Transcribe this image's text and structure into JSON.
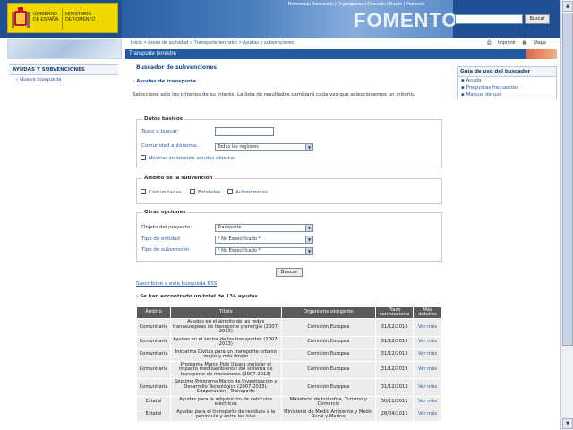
{
  "header": {
    "gov_line1": "GOBIERNO",
    "gov_line2": "DE ESPAÑA",
    "ministry_line1": "MINISTERIO",
    "ministry_line2": "DE FOMENTO",
    "topnav": "Bienvenida Bienvenido | Organigrama | Dirección | Buzón | Protocolo",
    "brand": "FOMENTO",
    "search_button": "Buscar"
  },
  "breadcrumb": "Inicio > Áreas de actividad > Transporte terrestre > Ayudas y subvenciones",
  "util": {
    "print": "Imprimir",
    "map": "Mapa"
  },
  "section_title": "Transporte terrestre",
  "sidebar": {
    "title": "AYUDAS Y SUBVENCIONES",
    "items": [
      "Nueva búsqueda"
    ]
  },
  "main": {
    "title": "Buscador de subvenciones",
    "subtitle": "Ayudas de transporte",
    "intro": "Seleccione sólo los criterios de su interés. La lista de resultados cambiará cada vez que seleccionemos un criterio.",
    "basic": {
      "legend": "Datos básicos",
      "text_label": "Texto a buscar:",
      "text_value": "",
      "community_label": "Comunidad autónoma:",
      "community_value": "Todas las regiones",
      "open_only_label": "Mostrar solamente ayudas abiertas"
    },
    "scope": {
      "legend": "Ámbito de la subvención",
      "options": [
        "Comunitarias",
        "Estatales",
        "Autonómicas"
      ]
    },
    "other": {
      "legend": "Otras opciones",
      "object_label": "Objeto del proyecto:",
      "object_value": "Transporte",
      "entity_label": "Tipo de entidad",
      "entity_value": "* No Especificado *",
      "subsidy_label": "Tipo de subvención",
      "subsidy_value": "* No Especificado *"
    },
    "search_button": "Buscar",
    "rss_link": "Suscribirse a esta búsqueda RSS",
    "found_text": "Se han encontrado un total de 134 ayudas"
  },
  "table": {
    "headers": [
      "Ámbito",
      "Título",
      "Organismo otorgante",
      "Plazo convocatoria",
      "Más detalles"
    ],
    "rows": [
      [
        "Comunitaria",
        "Ayudas en el ámbito de las redes transeuropeas de transporte y energía (2007-2013)",
        "Comisión Europea",
        "31/12/2013",
        "Ver más"
      ],
      [
        "Comunitaria",
        "Ayudas en el sector de los transportes (2007-2013)",
        "Comisión Europea",
        "31/12/2013",
        "Ver más"
      ],
      [
        "Comunitaria",
        "Iniciativa Civitas para un transporte urbano mejor y más limpio",
        "Comisión Europea",
        "31/12/2013",
        "Ver más"
      ],
      [
        "Comunitaria",
        "Programa Marco Polo II para mejorar el impacto medioambiental del sistema de transporte de mercancías (2007-2013)",
        "Comisión Europea",
        "31/12/2013",
        "Ver más"
      ],
      [
        "Comunitaria",
        "Séptimo Programa Marco de Investigación y Desarrollo Tecnológico (2007-2013). Cooperación - Transporte",
        "Comisión Europea",
        "31/12/2013",
        "Ver más"
      ],
      [
        "Estatal",
        "Ayudas para la adquisición de vehículos eléctricos",
        "Ministerio de Industria, Turismo y Comercio",
        "30/11/2011",
        "Ver más"
      ],
      [
        "Estatal",
        "Ayudas para el transporte de residuos a la península y entre las islas",
        "Ministerio de Medio Ambiente y Medio Rural y Marino",
        "28/04/2011",
        "Ver más"
      ]
    ]
  },
  "guide": {
    "title": "Guía de uso del buscador",
    "items": [
      "Ayuda",
      "Preguntas frecuentes",
      "Manual de uso"
    ]
  },
  "colors": {
    "brand_blue": "#1e4f93",
    "gov_yellow": "#f1d900",
    "table_header": "#5a5a5a"
  }
}
